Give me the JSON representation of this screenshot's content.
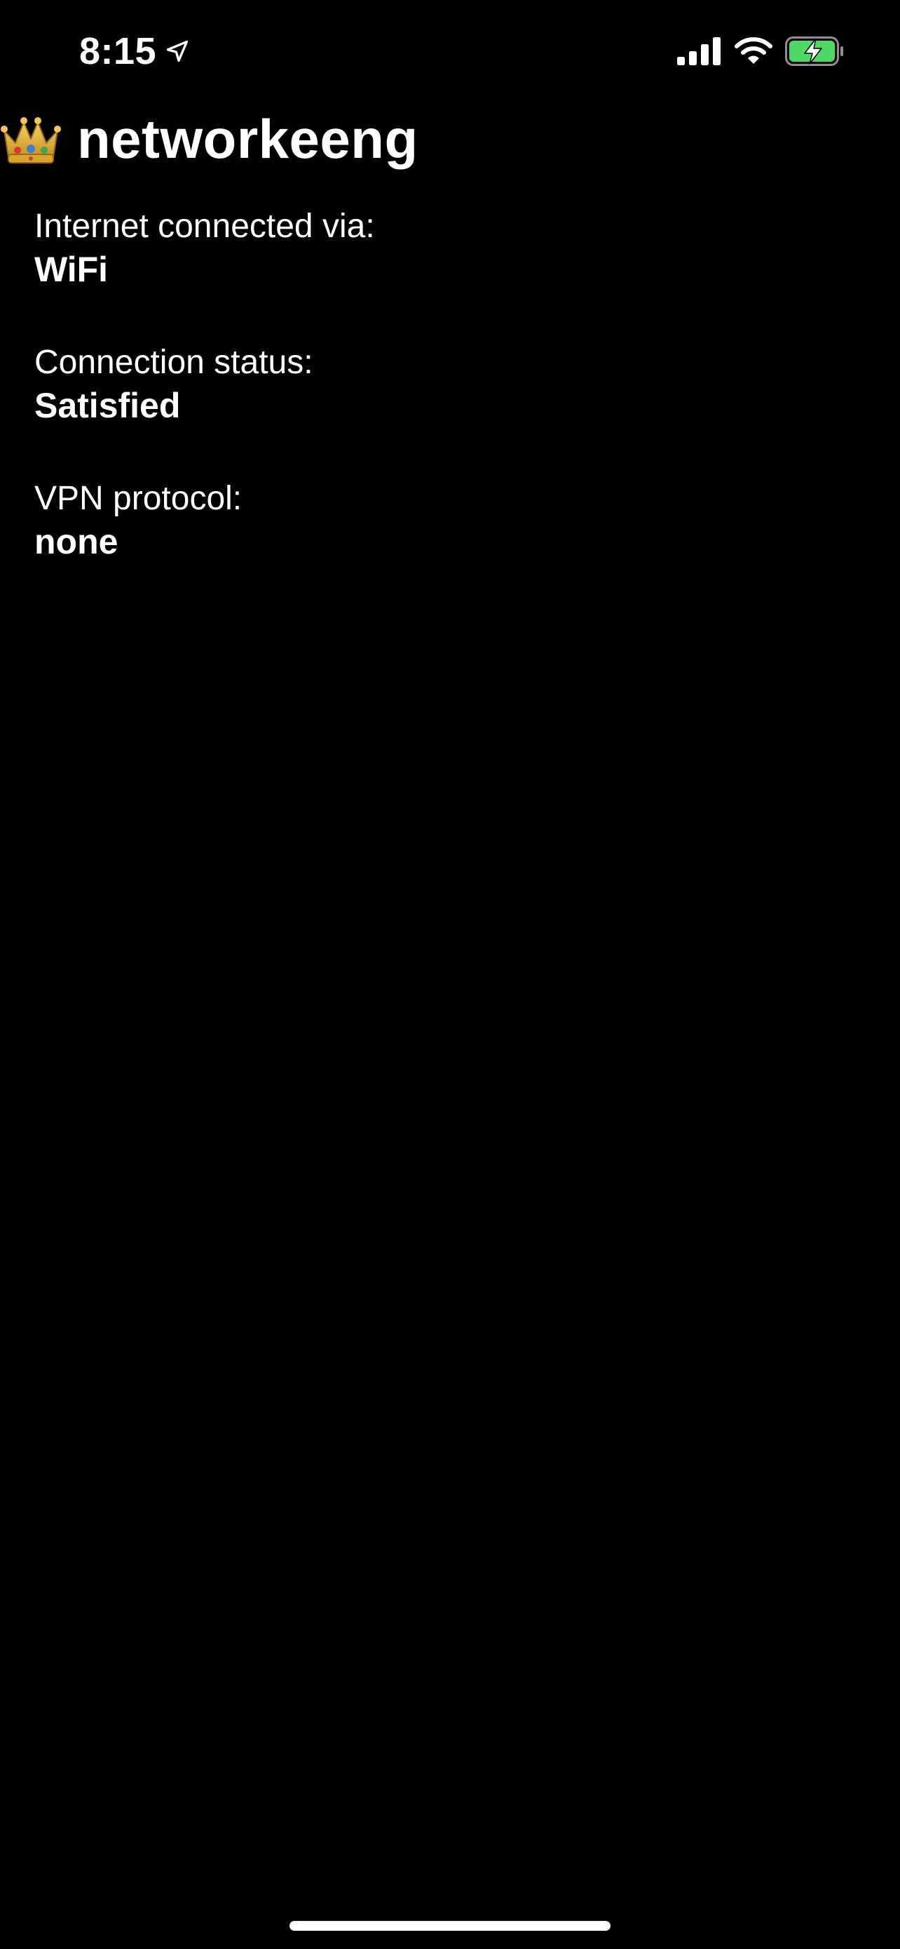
{
  "status_bar": {
    "time": "8:15",
    "location_icon": "location-arrow-icon",
    "signal_icon": "cellular-signal-icon",
    "wifi_icon": "wifi-icon",
    "battery_icon": "battery-charging-icon",
    "battery_color": "#4cd964"
  },
  "header": {
    "icon": "crown-icon",
    "title": "networkeeng"
  },
  "info": [
    {
      "label": "Internet connected via:",
      "value": "WiFi"
    },
    {
      "label": "Connection status:",
      "value": "Satisfied"
    },
    {
      "label": "VPN protocol:",
      "value": "none"
    }
  ],
  "colors": {
    "background": "#000000",
    "text": "#ffffff"
  }
}
